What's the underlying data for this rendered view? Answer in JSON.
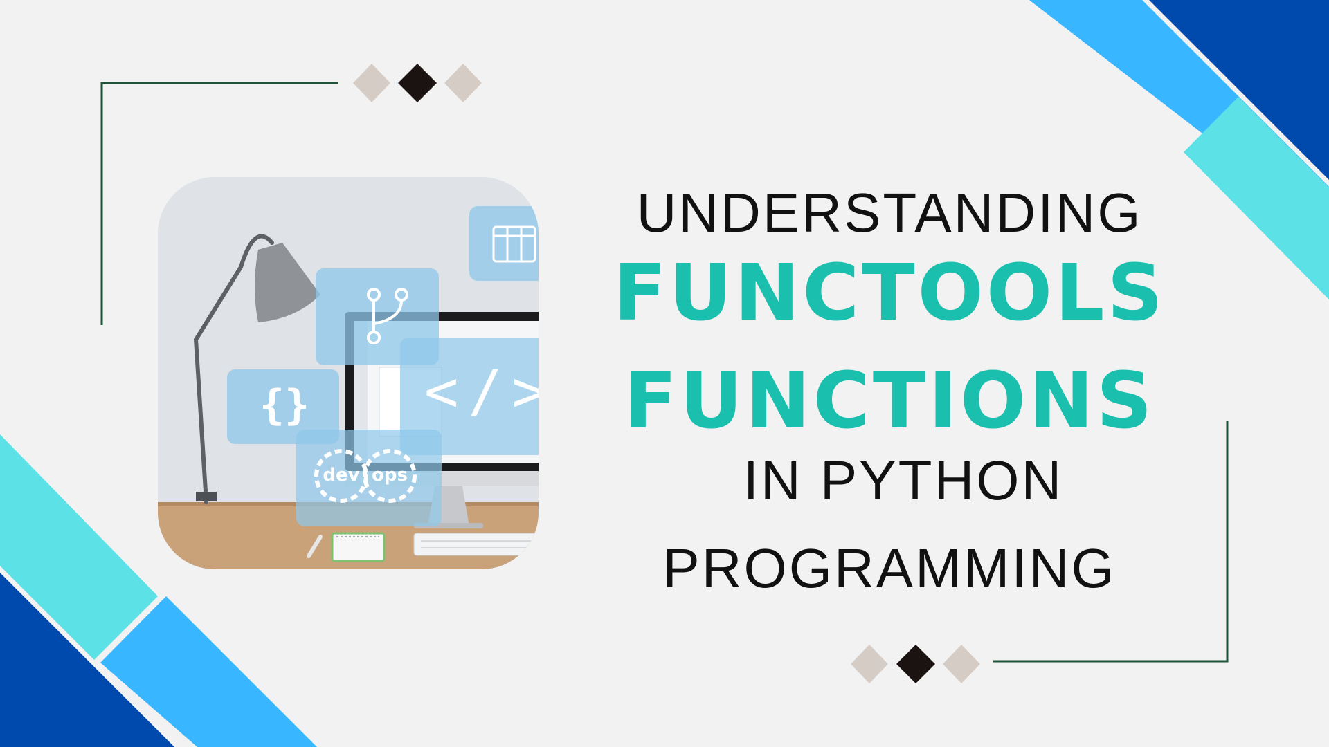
{
  "title": {
    "line1": "UNDERSTANDING",
    "line2": "FUNCTOOLS",
    "line3": "FUNCTIONS",
    "line4": "IN PYTHON",
    "line5": "PROGRAMMING"
  },
  "photo": {
    "braces_label": "{}",
    "code_tag_label": "</>",
    "devops_dev": "dev",
    "devops_ops": "ops",
    "icons": [
      "desk-lamp-icon",
      "git-branch-icon",
      "curly-braces-icon",
      "code-tag-icon",
      "devops-gears-icon",
      "kanban-board-icon",
      "monitor-icon",
      "keyboard-icon",
      "notepad-icon",
      "pen-icon"
    ]
  },
  "colors": {
    "background": "#f2f2f2",
    "accent_teal": "#1bbfae",
    "text_dark": "#111111",
    "frame_line": "#1e5438",
    "diamond_light": "#d6ccc6",
    "diamond_dark": "#1a1311",
    "stripe_light_blue": "#38b6ff",
    "stripe_cyan": "#5ce1e6",
    "stripe_dark_blue": "#004aad"
  }
}
